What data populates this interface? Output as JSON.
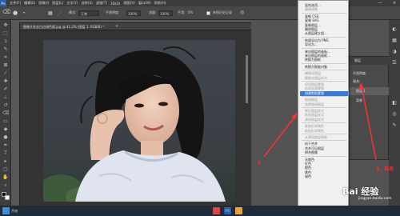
{
  "menubar": {
    "items": [
      "文件(F)",
      "编辑(E)",
      "图像(I)",
      "图层(L)",
      "文字(Y)",
      "选择(S)",
      "滤镜(T)",
      "3D(D)",
      "视图(V)",
      "窗口(W)",
      "帮助(H)"
    ],
    "minimize": "—",
    "close": "×"
  },
  "options": {
    "mode_label": "模式:",
    "mode_value": "正常",
    "opacity_label": "不透明度:",
    "opacity_value": "100%",
    "flow_label": "流量:",
    "flow_value": "100%",
    "smoothing_label": "平滑:",
    "smoothing_value": "0%",
    "erase_to_history": "抹到历史记录"
  },
  "document": {
    "tab_title": "图像头发去白边调色版.jpg @ 41.2% (图层 1, RGB/8) *",
    "status_zoom": "41.22%",
    "status_doc": "文档:1.54M/1.54M"
  },
  "layers": {
    "header": "图层",
    "rows": [
      "不透明度:",
      "填充:",
      "图层 1",
      "背景"
    ]
  },
  "context_menu": {
    "items": [
      {
        "label": "混合选项...",
        "state": "normal"
      },
      {
        "label": "编辑调整...",
        "state": "dim"
      },
      {
        "sep": true
      },
      {
        "label": "复制 CSS",
        "state": "normal"
      },
      {
        "label": "复制 SVG",
        "state": "normal"
      },
      {
        "label": "复制图层...",
        "state": "normal"
      },
      {
        "label": "删除图层",
        "state": "normal"
      },
      {
        "label": "从图层建立组...",
        "state": "normal"
      },
      {
        "sep": true
      },
      {
        "label": "快速导出为 PNG",
        "state": "normal"
      },
      {
        "label": "导出为...",
        "state": "normal"
      },
      {
        "sep": true
      },
      {
        "label": "来自图层的画板...",
        "state": "normal"
      },
      {
        "label": "来自图层的画框...",
        "state": "normal"
      },
      {
        "label": "转换为图框",
        "state": "normal"
      },
      {
        "sep": true
      },
      {
        "label": "转换为智能对象",
        "state": "normal"
      },
      {
        "sep": true
      },
      {
        "label": "栅格化图层",
        "state": "dim"
      },
      {
        "label": "栅格化图层样式",
        "state": "dim"
      },
      {
        "sep": true
      },
      {
        "label": "停用图层蒙版",
        "state": "dim"
      },
      {
        "label": "启用矢量蒙版",
        "state": "dim"
      },
      {
        "label": "创建剪贴蒙版",
        "state": "highlight"
      },
      {
        "sep": true
      },
      {
        "label": "链接图层",
        "state": "dim"
      },
      {
        "label": "选择链接图层",
        "state": "dim"
      },
      {
        "sep": true
      },
      {
        "label": "拷贝图层样式",
        "state": "dim"
      },
      {
        "label": "粘贴图层样式",
        "state": "dim"
      },
      {
        "label": "清除图层样式",
        "state": "dim"
      },
      {
        "sep": true
      },
      {
        "label": "复制形状属性",
        "state": "dim"
      },
      {
        "label": "粘贴形状属性",
        "state": "dim"
      },
      {
        "sep": true
      },
      {
        "label": "从隔离图层释放",
        "state": "dim"
      },
      {
        "sep": true
      },
      {
        "label": "向下合并",
        "state": "normal"
      },
      {
        "label": "合并可见图层",
        "state": "normal"
      },
      {
        "label": "拼合图像",
        "state": "normal"
      },
      {
        "sep": true
      },
      {
        "label": "无颜色",
        "state": "normal"
      },
      {
        "label": "红色",
        "state": "normal"
      },
      {
        "label": "橙色",
        "state": "normal"
      },
      {
        "label": "黄色",
        "state": "normal"
      },
      {
        "label": "绿色",
        "state": "normal"
      }
    ]
  },
  "annotations": {
    "one": "1、右击",
    "two": "2"
  },
  "watermark": {
    "brand": "Bai 经验",
    "url": "jingyan.baidu.com"
  },
  "taskbar": {
    "start": "开始",
    "label": "PS"
  },
  "colors": {
    "accent": "#3a7bd5",
    "annotation": "#ff3030"
  }
}
